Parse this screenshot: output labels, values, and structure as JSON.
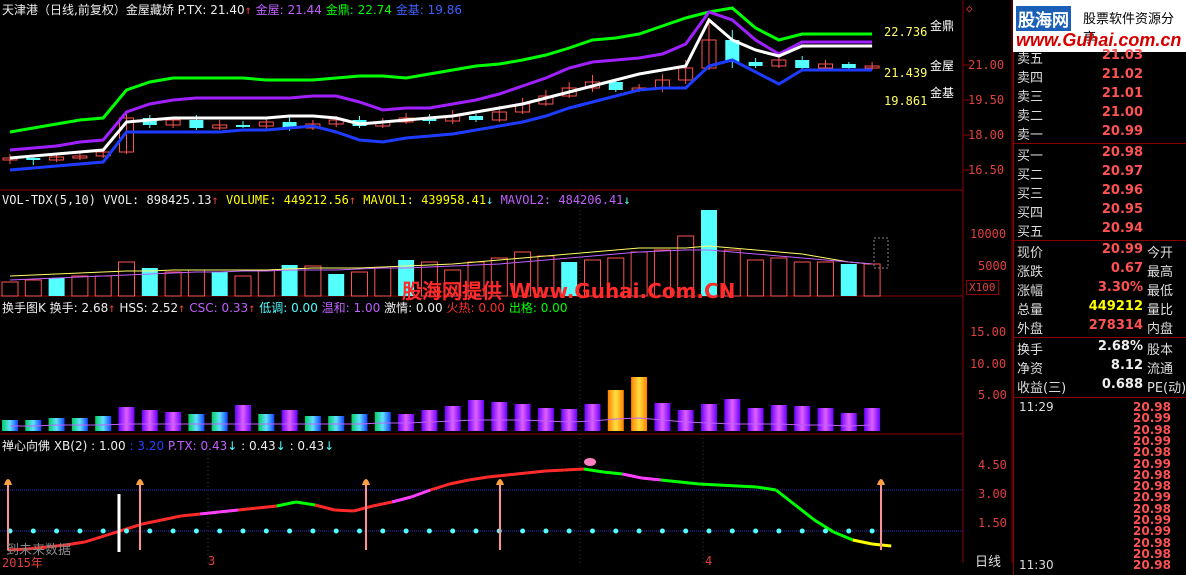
{
  "header": {
    "title": "天津港（日线,前复权）金屋藏娇",
    "ptx_label": "P.TX: 21.40",
    "jinwu_label": "金屋: 21.44",
    "jinding_label": "金鼎: 22.74",
    "jinji_label": "金基: 19.86"
  },
  "price_axis": {
    "ticks": [
      "21.00",
      "19.50",
      "18.00",
      "16.50"
    ],
    "jinding_value": "22.736",
    "jinwu_value": "21.439",
    "jinji_value": "19.861",
    "jinding_tag": "金鼎",
    "jinwu_tag": "金屋",
    "jinji_tag": "金基"
  },
  "volume_panel": {
    "header": "VOL-TDX(5,10) VVOL: 898425.13",
    "volume": "VOLUME: 449212.56",
    "mavol1": "MAVOL1: 439958.41",
    "mavol2": "MAVOL2: 484206.41",
    "ticks": [
      "10000",
      "5000"
    ],
    "unit": "X100"
  },
  "turnover_panel": {
    "header": "换手图K 换手: 2.68",
    "hss": "HSS: 2.52",
    "csc": "CSC: 0.33",
    "low": "低调: 0.00",
    "mild": "温和: 1.00",
    "excited": "激情: 0.00",
    "hot": "火热: 0.00",
    "out": "出格: 0.00",
    "ticks": [
      "15.00",
      "10.00",
      "5.00"
    ]
  },
  "buddha_panel": {
    "header": "禅心向佛 XB(2) : 1.00",
    "v2": ": 3.20",
    "ptx": "P.TX: 0.43",
    "v4": ": 0.43",
    "v5": ": 0.43",
    "ticks": [
      "4.50",
      "3.00",
      "1.50"
    ],
    "footer_text": "到未来数据"
  },
  "watermark": "股海网提供 Www.Guhai.Com.CN",
  "time_axis": {
    "year": "2015年",
    "m3": "3",
    "m4": "4",
    "period": "日线"
  },
  "logo": {
    "brand": "股海网",
    "slogan": "股票软件资源分享",
    "url": "www.Guhai.com.cn"
  },
  "order_book": {
    "asks": [
      {
        "label": "卖五",
        "price": "21.03"
      },
      {
        "label": "卖四",
        "price": "21.02"
      },
      {
        "label": "卖三",
        "price": "21.01"
      },
      {
        "label": "卖二",
        "price": "21.00"
      },
      {
        "label": "卖一",
        "price": "20.99"
      }
    ],
    "bids": [
      {
        "label": "买一",
        "price": "20.98"
      },
      {
        "label": "买二",
        "price": "20.97"
      },
      {
        "label": "买三",
        "price": "20.96"
      },
      {
        "label": "买四",
        "price": "20.95"
      },
      {
        "label": "买五",
        "price": "20.94"
      }
    ]
  },
  "quote": [
    {
      "label": "现价",
      "value": "20.99",
      "label2": "今开",
      "color": "red"
    },
    {
      "label": "涨跌",
      "value": "0.67",
      "label2": "最高",
      "color": "red"
    },
    {
      "label": "涨幅",
      "value": "3.30%",
      "label2": "最低",
      "color": "red"
    },
    {
      "label": "总量",
      "value": "449212",
      "label2": "量比",
      "color": "yellow"
    },
    {
      "label": "外盘",
      "value": "278314",
      "label2": "内盘",
      "color": "red"
    }
  ],
  "stats": [
    {
      "label": "换手",
      "value": "2.68%",
      "label2": "股本"
    },
    {
      "label": "净资",
      "value": "8.12",
      "label2": "流通"
    },
    {
      "label": "收益(三)",
      "value": "0.688",
      "label2": "PE(动)"
    }
  ],
  "ticks_list": [
    {
      "time": "11:29",
      "price": "20.98"
    },
    {
      "time": "",
      "price": "20.99"
    },
    {
      "time": "",
      "price": "20.98"
    },
    {
      "time": "",
      "price": "20.99"
    },
    {
      "time": "",
      "price": "20.98"
    },
    {
      "time": "",
      "price": "20.99"
    },
    {
      "time": "",
      "price": "20.98"
    },
    {
      "time": "",
      "price": "20.98"
    },
    {
      "time": "",
      "price": "20.99"
    },
    {
      "time": "",
      "price": "20.98"
    },
    {
      "time": "",
      "price": "20.99"
    },
    {
      "time": "",
      "price": "20.99"
    },
    {
      "time": "",
      "price": "20.98"
    },
    {
      "time": "",
      "price": "20.98"
    },
    {
      "time": "11:30",
      "price": "20.98"
    }
  ],
  "colors": {
    "background": "#000000",
    "up": "#ff5252",
    "down": "#54ffff",
    "jinding": "#00ff00",
    "jinwu": "#a020ff",
    "jinji": "#1e3cff",
    "frame": "#8b0000"
  }
}
